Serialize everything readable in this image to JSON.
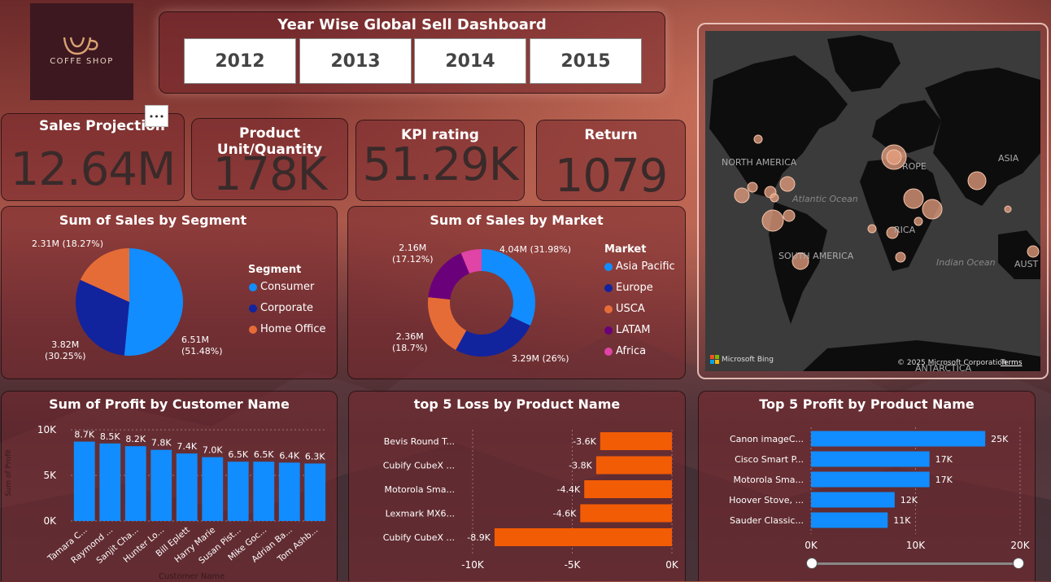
{
  "logo": {
    "text": "COFFE SHOP"
  },
  "header": {
    "title": "Year Wise Global Sell Dashboard",
    "years": [
      "2012",
      "2013",
      "2014",
      "2015"
    ]
  },
  "kpis": [
    {
      "label": "Sales Projection",
      "value": "12.64M"
    },
    {
      "label": "Product Unit/Quantity",
      "value": "178K"
    },
    {
      "label": "KPI rating",
      "value": "51.29K"
    },
    {
      "label": "Return",
      "value": "1079"
    }
  ],
  "more_menu": {
    "label": "•••"
  },
  "map": {
    "labels": [
      "NORTH AMERICA",
      "Atlantic Ocean",
      "ROPE",
      "ASIA",
      "RICA",
      "SOUTH AMERICA",
      "Indian Ocean",
      "AUST",
      "ANTARCTICA"
    ],
    "attribution": "Microsoft Bing",
    "copyright": "© 2025 Microsoft Corporation",
    "terms": "Terms",
    "bubble_color": "#e8a080"
  },
  "segment_chart": {
    "title": "Sum of Sales by Segment",
    "legend_title": "Segment",
    "labels": {
      "consumer": "6.51M\n(51.48%)",
      "corporate": "3.82M\n(30.25%)",
      "home": "2.31M (18.27%)"
    }
  },
  "market_chart": {
    "title": "Sum of Sales by Market",
    "legend_title": "Market",
    "labels": {
      "asia": "4.04M (31.98%)",
      "europe": "3.29M (26%)",
      "usca": "2.36M\n(18.7%)",
      "latam": "2.16M\n(17.12%)"
    }
  },
  "profit_customer": {
    "title": "Sum of Profit by Customer Name",
    "ylabel": "Sum of Profit",
    "xlabel": "Customer Name"
  },
  "loss_products": {
    "title": "top 5 Loss by Product Name"
  },
  "profit_products": {
    "title": "Top 5 Profit by Product Name"
  },
  "chart_data": [
    {
      "type": "pie",
      "title": "Sum of Sales by Segment",
      "categories": [
        "Consumer",
        "Corporate",
        "Home Office"
      ],
      "values": [
        6.51,
        3.82,
        2.31
      ],
      "percents": [
        51.48,
        30.25,
        18.27
      ],
      "colors": [
        "#118dff",
        "#12239e",
        "#e66c37"
      ],
      "legend": "right"
    },
    {
      "type": "pie",
      "subtype": "donut",
      "title": "Sum of Sales by Market",
      "categories": [
        "Asia Pacific",
        "Europe",
        "USCA",
        "LATAM",
        "Africa"
      ],
      "values": [
        4.04,
        3.29,
        2.36,
        2.16,
        0.79
      ],
      "percents": [
        31.98,
        26,
        18.7,
        17.12,
        6.2
      ],
      "colors": [
        "#118dff",
        "#12239e",
        "#e66c37",
        "#6b007b",
        "#e044a7"
      ],
      "legend": "right"
    },
    {
      "type": "bar",
      "title": "Sum of Profit by Customer Name",
      "categories": [
        "Tamara C...",
        "Raymond ...",
        "Sanjit Cha...",
        "Hunter Lo...",
        "Bill Eplett",
        "Harry Marie",
        "Susan Pist...",
        "Mike Goc...",
        "Adrian Ba...",
        "Tom Ashb..."
      ],
      "values": [
        8.7,
        8.5,
        8.2,
        7.8,
        7.4,
        7.0,
        6.5,
        6.5,
        6.4,
        6.3
      ],
      "value_labels": [
        "8.7K",
        "8.5K",
        "8.2K",
        "7.8K",
        "7.4K",
        "7.0K",
        "6.5K",
        "6.5K",
        "6.4K",
        "6.3K"
      ],
      "yticks": [
        "0K",
        "5K",
        "10K"
      ],
      "ylim": [
        0,
        10
      ],
      "ylabel": "Sum of Profit",
      "xlabel": "Customer Name",
      "color": "#118dff"
    },
    {
      "type": "bar",
      "orientation": "horizontal",
      "title": "top 5 Loss by Product Name",
      "categories": [
        "Bevis Round T...",
        "Cubify CubeX ...",
        "Motorola Sma...",
        "Lexmark MX6...",
        "Cubify CubeX ..."
      ],
      "values": [
        -3.6,
        -3.8,
        -4.4,
        -4.6,
        -8.9
      ],
      "value_labels": [
        "-3.6K",
        "-3.8K",
        "-4.4K",
        "-4.6K",
        "-8.9K"
      ],
      "xticks": [
        "-10K",
        "-5K",
        "0K"
      ],
      "xlim": [
        -10,
        0
      ],
      "color": "#f25c05"
    },
    {
      "type": "bar",
      "orientation": "horizontal",
      "title": "Top 5 Profit by Product Name",
      "categories": [
        "Canon imageC...",
        "Cisco Smart P...",
        "Motorola Sma...",
        "Hoover Stove, ...",
        "Sauder Classic..."
      ],
      "values": [
        25,
        17,
        17,
        12,
        11
      ],
      "value_labels": [
        "25K",
        "17K",
        "17K",
        "12K",
        "11K"
      ],
      "xticks": [
        "0K",
        "10K",
        "20K"
      ],
      "xlim": [
        0,
        30
      ],
      "color": "#118dff"
    }
  ]
}
